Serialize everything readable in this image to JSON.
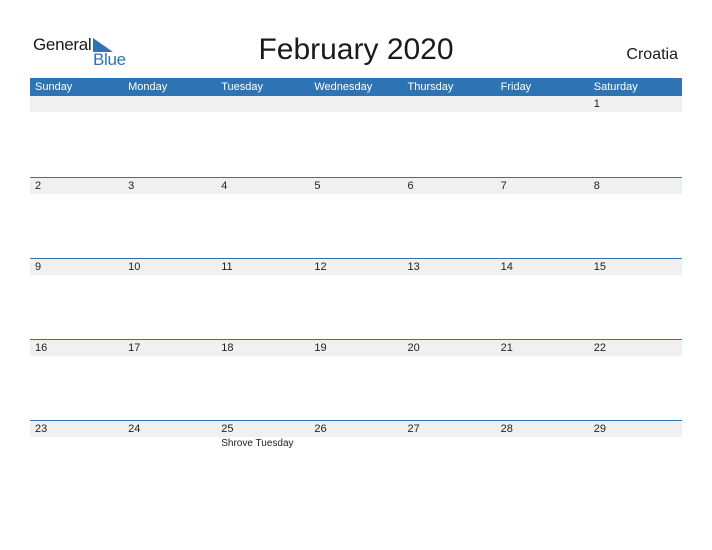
{
  "logo": {
    "part1": "General",
    "part2": "Blue",
    "icon": "triangle-flag-icon"
  },
  "title": "February 2020",
  "country": "Croatia",
  "weekdays": [
    "Sunday",
    "Monday",
    "Tuesday",
    "Wednesday",
    "Thursday",
    "Friday",
    "Saturday"
  ],
  "weeks": [
    {
      "days": [
        "",
        "",
        "",
        "",
        "",
        "",
        "1"
      ],
      "events": [
        "",
        "",
        "",
        "",
        "",
        "",
        ""
      ]
    },
    {
      "days": [
        "2",
        "3",
        "4",
        "5",
        "6",
        "7",
        "8"
      ],
      "events": [
        "",
        "",
        "",
        "",
        "",
        "",
        ""
      ]
    },
    {
      "days": [
        "9",
        "10",
        "11",
        "12",
        "13",
        "14",
        "15"
      ],
      "events": [
        "",
        "",
        "",
        "",
        "",
        "",
        ""
      ]
    },
    {
      "days": [
        "16",
        "17",
        "18",
        "19",
        "20",
        "21",
        "22"
      ],
      "events": [
        "",
        "",
        "",
        "",
        "",
        "",
        ""
      ]
    },
    {
      "days": [
        "23",
        "24",
        "25",
        "26",
        "27",
        "28",
        "29"
      ],
      "events": [
        "",
        "",
        "Shrove Tuesday",
        "",
        "",
        "",
        ""
      ]
    }
  ],
  "colors": {
    "accent": "#2e74b5",
    "day_row_bg": "#f0f0f0"
  }
}
